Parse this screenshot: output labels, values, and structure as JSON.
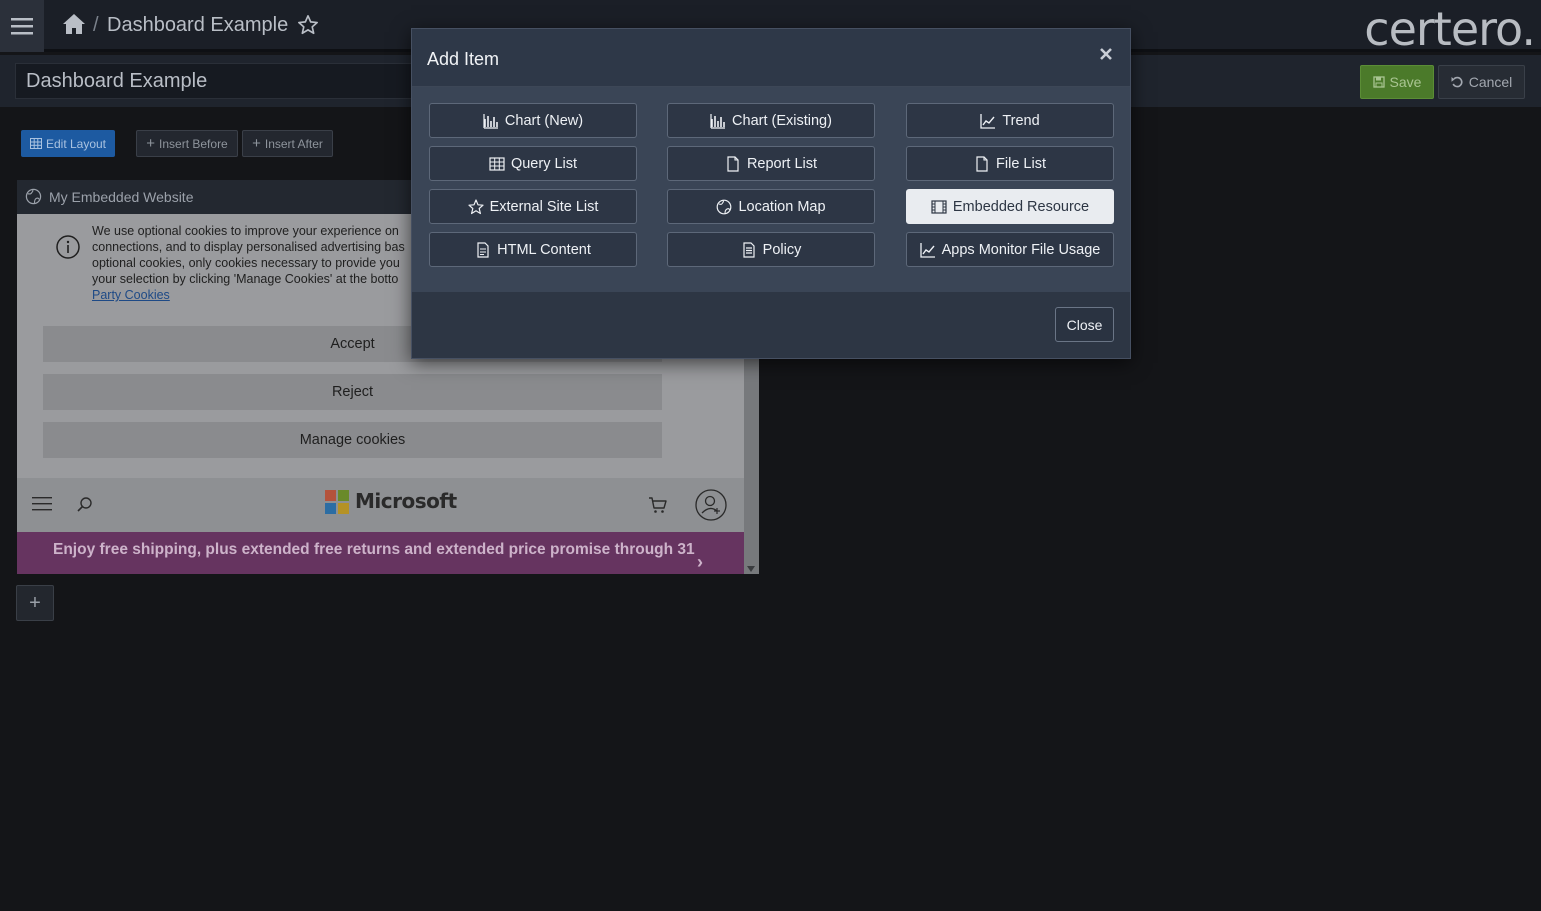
{
  "header": {
    "breadcrumb_separator": "/",
    "title": "Dashboard Example",
    "logo_text": "certero."
  },
  "subheader": {
    "title_value": "Dashboard Example",
    "save_label": "Save",
    "cancel_label": "Cancel",
    "save_color": "#4b7a2a"
  },
  "toolbar": {
    "edit_layout_label": "Edit Layout",
    "insert_before_label": "Insert Before",
    "insert_after_label": "Insert After"
  },
  "widget": {
    "title": "My Embedded Website",
    "cookie_text_lines": [
      "We use optional cookies to improve your experience on",
      "connections, and to display personalised advertising bas",
      "optional cookies, only cookies necessary to provide you",
      "your selection by clicking 'Manage Cookies' at the botto"
    ],
    "cookie_link": "Party Cookies",
    "accept_label": "Accept",
    "reject_label": "Reject",
    "manage_label": "Manage cookies",
    "ms_brand": "Microsoft",
    "promo_text": "Enjoy free shipping, plus extended free returns and extended price promise through 31",
    "promo_chevron": "›",
    "add_row_symbol": "+"
  },
  "modal": {
    "title": "Add Item",
    "close_label": "Close",
    "items": [
      {
        "label": "Chart (New)",
        "icon": "chart-icon"
      },
      {
        "label": "Chart (Existing)",
        "icon": "chart-icon"
      },
      {
        "label": "Trend",
        "icon": "trend-icon"
      },
      {
        "label": "Query List",
        "icon": "table-icon"
      },
      {
        "label": "Report List",
        "icon": "file-icon"
      },
      {
        "label": "File List",
        "icon": "file-icon"
      },
      {
        "label": "External Site List",
        "icon": "star-icon"
      },
      {
        "label": "Location Map",
        "icon": "globe-icon"
      },
      {
        "label": "Embedded Resource",
        "icon": "film-icon",
        "selected": true
      },
      {
        "label": "HTML Content",
        "icon": "file-text-icon"
      },
      {
        "label": "Policy",
        "icon": "policy-icon"
      },
      {
        "label": "Apps Monitor File Usage",
        "icon": "trend-icon"
      }
    ]
  }
}
